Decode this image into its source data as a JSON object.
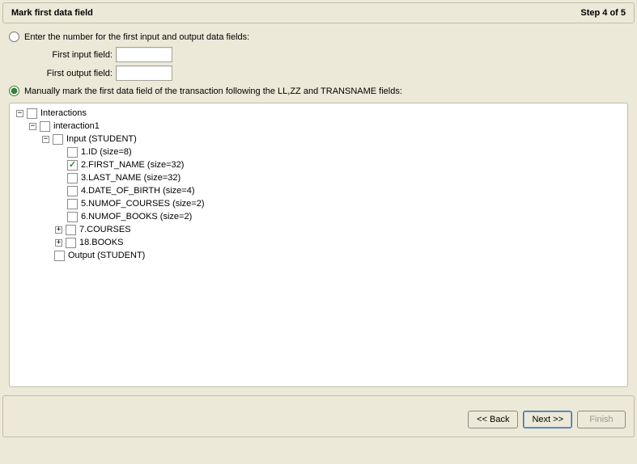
{
  "header": {
    "title": "Mark first data field",
    "step": "Step 4 of 5"
  },
  "option1": {
    "label": "Enter the number for the first input and output data fields:",
    "firstInputLabel": "First input field:",
    "firstInputValue": "",
    "firstOutputLabel": "First output field:",
    "firstOutputValue": ""
  },
  "option2": {
    "label": "Manually mark the first data field of the transaction following the LL,ZZ and TRANSNAME fields:"
  },
  "tree": {
    "root": "Interactions",
    "interaction": "interaction1",
    "input": "Input (STUDENT)",
    "fields": {
      "f1": "1.ID (size=8)",
      "f2": "2.FIRST_NAME (size=32)",
      "f3": "3.LAST_NAME (size=32)",
      "f4": "4.DATE_OF_BIRTH (size=4)",
      "f5": "5.NUMOF_COURSES (size=2)",
      "f6": "6.NUMOF_BOOKS (size=2)",
      "f7": "7.COURSES",
      "f8": "18.BOOKS"
    },
    "output": "Output (STUDENT)"
  },
  "buttons": {
    "back": "<< Back",
    "next": "Next >>",
    "finish": "Finish"
  }
}
